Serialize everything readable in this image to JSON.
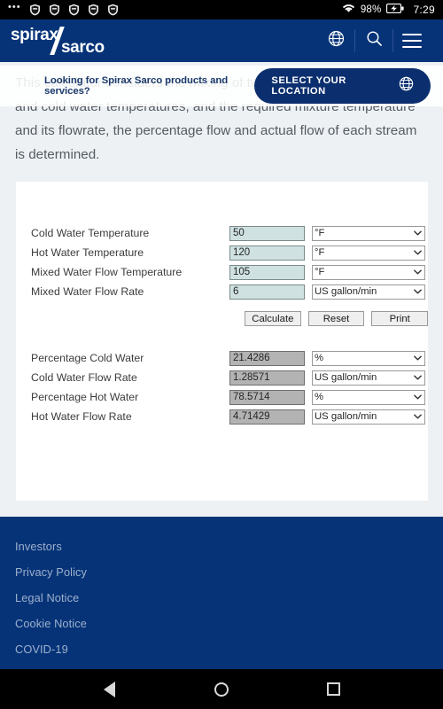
{
  "status_bar": {
    "overflow_dots": "•••",
    "notification_icons": [
      "shield-icon",
      "shield-icon",
      "shield-icon",
      "shield-icon",
      "shield-icon"
    ],
    "wifi": "wifi-icon",
    "battery_percent": "98%",
    "battery": "battery-charging-icon",
    "time": "7:29"
  },
  "header": {
    "logo_top": "spirax",
    "logo_bottom": "sarco",
    "globe_icon": "globe-icon",
    "search_icon": "search-icon",
    "menu_icon": "hamburger-menu-icon",
    "background_color": "#063378"
  },
  "intro": {
    "paragraph": "This calculator considers the mixing of two streams. Knowing the hot and cold water temperatures, and the required mixture temperature and its flowrate, the percentage flow and actual flow of each stream is determined."
  },
  "location_banner": {
    "message": "Looking for Spirax Sarco products and services?",
    "button_label": "SELECT YOUR LOCATION",
    "button_icon": "globe-icon",
    "button_color": "#0b2f6e"
  },
  "calculator": {
    "inputs": [
      {
        "label": "Cold Water Temperature",
        "value": "50",
        "unit": "°F"
      },
      {
        "label": "Hot Water Temperature",
        "value": "120",
        "unit": "°F"
      },
      {
        "label": "Mixed Water Flow Temperature",
        "value": "105",
        "unit": "°F"
      },
      {
        "label": "Mixed Water Flow Rate",
        "value": "6",
        "unit": "US gallon/min"
      }
    ],
    "buttons": [
      {
        "label": "Calculate"
      },
      {
        "label": "Reset"
      },
      {
        "label": "Print"
      }
    ],
    "results": [
      {
        "label": "Percentage Cold Water",
        "value": "21.4286",
        "unit": "%"
      },
      {
        "label": "Cold Water Flow Rate",
        "value": "1.28571",
        "unit": "US gallon/min"
      },
      {
        "label": "Percentage Hot Water",
        "value": "78.5714",
        "unit": "%"
      },
      {
        "label": "Hot Water Flow Rate",
        "value": "4.71429",
        "unit": "US gallon/min"
      }
    ]
  },
  "footer": {
    "links": [
      {
        "label": "Investors"
      },
      {
        "label": "Privacy Policy"
      },
      {
        "label": "Legal Notice"
      },
      {
        "label": "Cookie Notice"
      },
      {
        "label": "COVID-19"
      }
    ]
  },
  "nav_bar": {
    "back": "back-triangle-icon",
    "home": "home-circle-icon",
    "recents": "recents-square-icon"
  }
}
